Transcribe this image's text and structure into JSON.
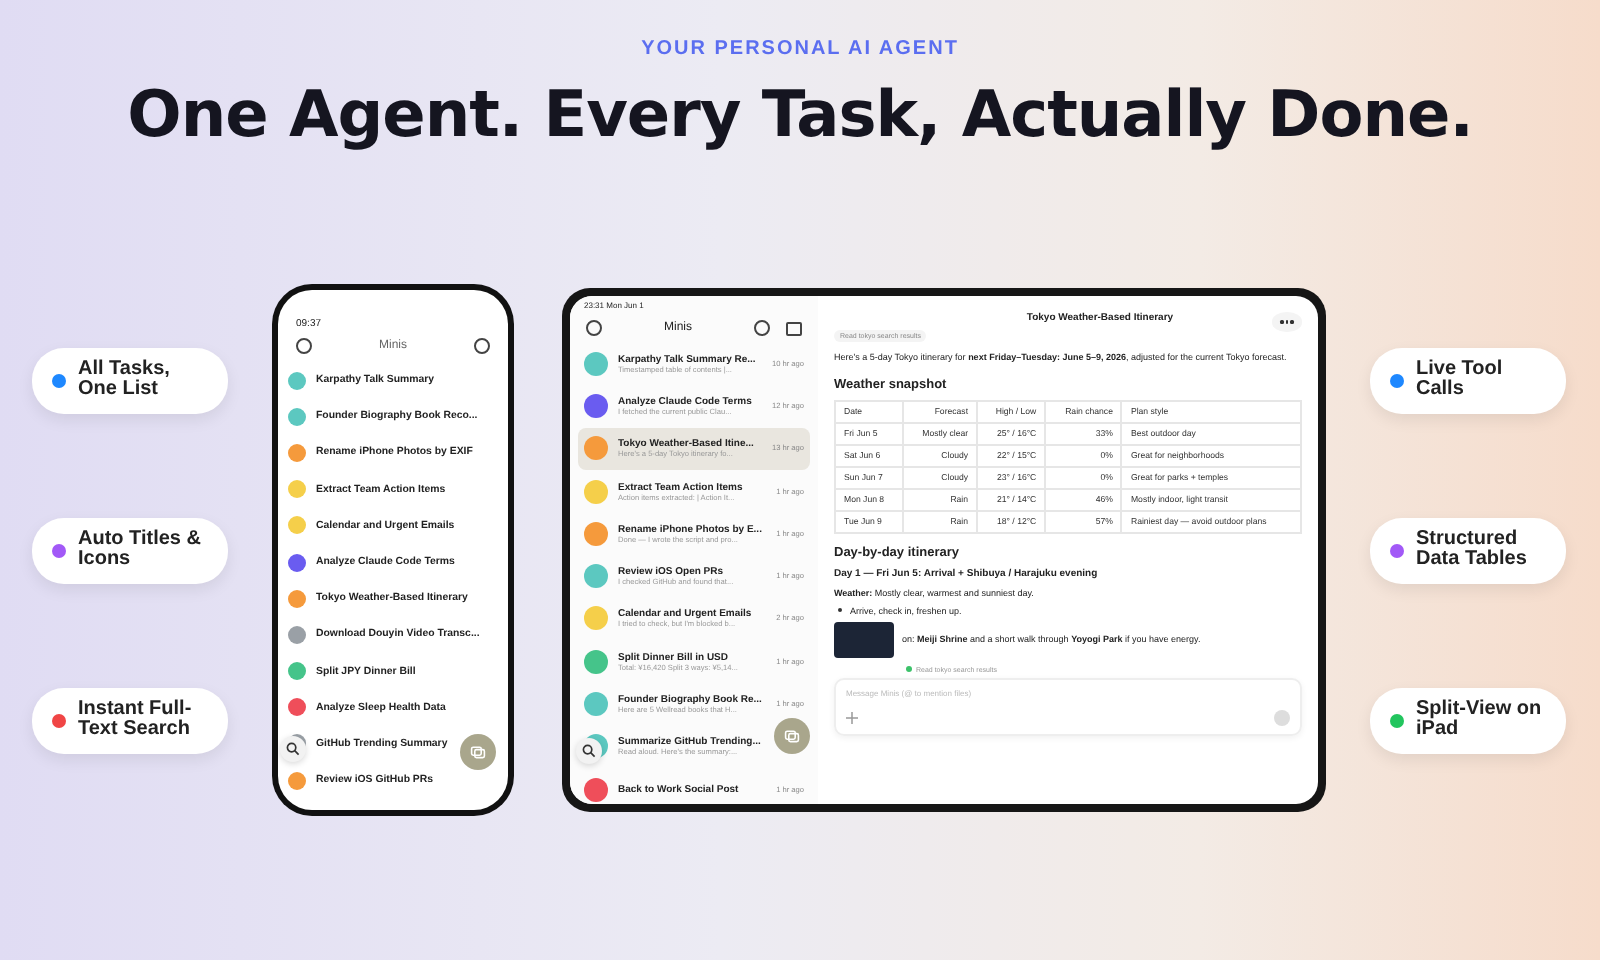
{
  "header": {
    "eyebrow": "YOUR PERSONAL AI AGENT",
    "title": "One Agent. Every Task, Actually Done."
  },
  "features_left": [
    {
      "label": "All Tasks, One List",
      "color": "#1e88ff"
    },
    {
      "label": "Auto Titles & Icons",
      "color": "#a259f7"
    },
    {
      "label": "Instant Full-Text Search",
      "color": "#f04545"
    }
  ],
  "features_right": [
    {
      "label": "Live Tool Calls",
      "color": "#1e88ff"
    },
    {
      "label": "Structured Data Tables",
      "color": "#a259f7"
    },
    {
      "label": "Split-View on iPad",
      "color": "#22c55e"
    }
  ],
  "phone": {
    "time": "09:37",
    "title": "Minis",
    "items": [
      {
        "title": "Karpathy Talk Summary",
        "color": "#5cc8c0"
      },
      {
        "title": "Founder Biography Book Reco...",
        "color": "#5cc8c0"
      },
      {
        "title": "Rename iPhone Photos by EXIF",
        "color": "#f59a3c"
      },
      {
        "title": "Extract Team Action Items",
        "color": "#f5cf4a"
      },
      {
        "title": "Calendar and Urgent Emails",
        "color": "#f5cf4a"
      },
      {
        "title": "Analyze Claude Code Terms",
        "color": "#6a5cf0"
      },
      {
        "title": "Tokyo Weather-Based Itinerary",
        "color": "#f59a3c"
      },
      {
        "title": "Download Douyin Video Transc...",
        "color": "#9aa0a6"
      },
      {
        "title": "Split JPY Dinner Bill",
        "color": "#45c48a"
      },
      {
        "title": "Analyze Sleep Health Data",
        "color": "#ef4e5a"
      },
      {
        "title": "GitHub Trending Summary",
        "color": "#9aa0a6"
      },
      {
        "title": "Review iOS GitHub PRs",
        "color": "#f59a3c"
      }
    ]
  },
  "tablet": {
    "time": "23:31",
    "date": "Mon Jun 1",
    "sidebar_title": "Minis",
    "items": [
      {
        "title": "Karpathy Talk Summary Re...",
        "subtitle": "Timestamped table of contents |...",
        "time": "10 hr ago",
        "color": "#5cc8c0",
        "selected": false
      },
      {
        "title": "Analyze Claude Code Terms",
        "subtitle": "I fetched the current public Clau...",
        "time": "12 hr ago",
        "color": "#6a5cf0",
        "selected": false
      },
      {
        "title": "Tokyo Weather-Based Itine...",
        "subtitle": "Here's a 5-day Tokyo itinerary fo...",
        "time": "13 hr ago",
        "color": "#f59a3c",
        "selected": true
      },
      {
        "title": "Extract Team Action Items",
        "subtitle": "Action items extracted: | Action It...",
        "time": "1 hr ago",
        "color": "#f5cf4a",
        "selected": false
      },
      {
        "title": "Rename iPhone Photos by E...",
        "subtitle": "Done — I wrote the script and pro...",
        "time": "1 hr ago",
        "color": "#f59a3c",
        "selected": false
      },
      {
        "title": "Review iOS Open PRs",
        "subtitle": "I checked GitHub and found that...",
        "time": "1 hr ago",
        "color": "#5cc8c0",
        "selected": false
      },
      {
        "title": "Calendar and Urgent Emails",
        "subtitle": "I tried to check, but I'm blocked b...",
        "time": "2 hr ago",
        "color": "#f5cf4a",
        "selected": false
      },
      {
        "title": "Split Dinner Bill in USD",
        "subtitle": "Total: ¥16,420 Split 3 ways: ¥5,14...",
        "time": "1 hr ago",
        "color": "#45c48a",
        "selected": false
      },
      {
        "title": "Founder Biography Book Re...",
        "subtitle": "Here are 5 Wellread books that H...",
        "time": "1 hr ago",
        "color": "#5cc8c0",
        "selected": false
      },
      {
        "title": "Summarize GitHub Trending...",
        "subtitle": "Read aloud. Here's the summary:...",
        "color": "#5cc8c0",
        "selected": false
      },
      {
        "title": "Back to Work Social Post",
        "time": "1 hr ago",
        "color": "#ef4e5a",
        "selected": false
      }
    ],
    "chat": {
      "title": "Tokyo Weather-Based Itinerary",
      "tool_chip": "Read tokyo search results",
      "intro": "Here's a 5-day Tokyo itinerary for **next Friday–Tuesday: June 5–9, 2026**, adjusted for the current Tokyo forecast.",
      "snapshot_heading": "Weather snapshot",
      "table": {
        "columns": [
          "Date",
          "Forecast",
          "High / Low",
          "Rain chance",
          "Plan style"
        ],
        "rows": [
          [
            "Fri Jun 5",
            "Mostly clear",
            "25° / 16°C",
            "33%",
            "Best outdoor day"
          ],
          [
            "Sat Jun 6",
            "Cloudy",
            "22° / 15°C",
            "0%",
            "Great for neighborhoods"
          ],
          [
            "Sun Jun 7",
            "Cloudy",
            "23° / 16°C",
            "0%",
            "Great for parks + temples"
          ],
          [
            "Mon Jun 8",
            "Rain",
            "21° / 14°C",
            "46%",
            "Mostly indoor, light transit"
          ],
          [
            "Tue Jun 9",
            "Rain",
            "18° / 12°C",
            "57%",
            "Rainiest day — avoid outdoor plans"
          ]
        ]
      },
      "itinerary_heading": "Day-by-day itinerary",
      "day_heading": "Day 1 — Fri Jun 5: Arrival + Shibuya / Harajuku evening",
      "weather_line": "**Weather:** Mostly clear, warmest and sunniest day.",
      "bullets": [
        "Arrive, check in, freshen up.",
        "on: **Meiji Shrine** and a short walk through **Yoyogi Park** if you have energy."
      ],
      "tool_status": "Read tokyo search results",
      "input_placeholder": "Message Minis (@ to mention files)"
    }
  }
}
